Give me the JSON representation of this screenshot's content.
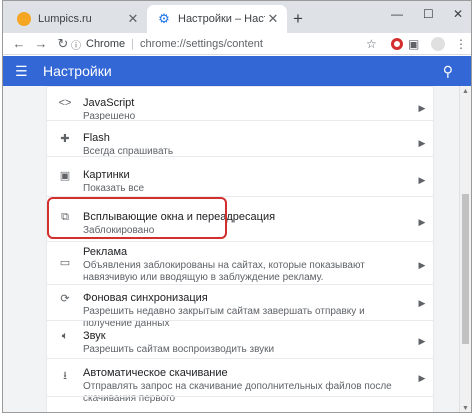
{
  "tabs": [
    {
      "title": "Lumpics.ru",
      "icon": "lumpics-favicon-icon",
      "active": false
    },
    {
      "title": "Настройки – Настройки сайта",
      "icon": "settings-gear-icon",
      "active": true
    }
  ],
  "toolbar": {
    "omnibox_label": "Chrome",
    "url": "chrome://settings/content"
  },
  "header": {
    "title": "Настройки"
  },
  "settings_rows": [
    {
      "title": "JavaScript",
      "subtitle": "Разрешено",
      "icon": "code-icon"
    },
    {
      "title": "Flash",
      "subtitle": "Всегда спрашивать",
      "icon": "puzzle-icon"
    },
    {
      "title": "Картинки",
      "subtitle": "Показать все",
      "icon": "image-icon"
    },
    {
      "title": "Всплывающие окна и переадресация",
      "subtitle": "Заблокировано",
      "icon": "open-in-new-icon"
    },
    {
      "title": "Реклама",
      "subtitle": "Объявления заблокированы на сайтах, которые показывают навязчивую или вводящую в заблуждение рекламу.",
      "icon": "ads-icon"
    },
    {
      "title": "Фоновая синхронизация",
      "subtitle": "Разрешить недавно закрытым сайтам завершать отправку и получение данных",
      "icon": "sync-icon"
    },
    {
      "title": "Звук",
      "subtitle": "Разрешить сайтам воспроизводить звуки",
      "icon": "volume-icon"
    },
    {
      "title": "Автоматическое скачивание",
      "subtitle": "Отправлять запрос на скачивание дополнительных файлов после скачивания первого",
      "icon": "download-icon"
    }
  ],
  "colors": {
    "header_bg": "#3367d6",
    "highlight_border": "#d32f2f"
  }
}
